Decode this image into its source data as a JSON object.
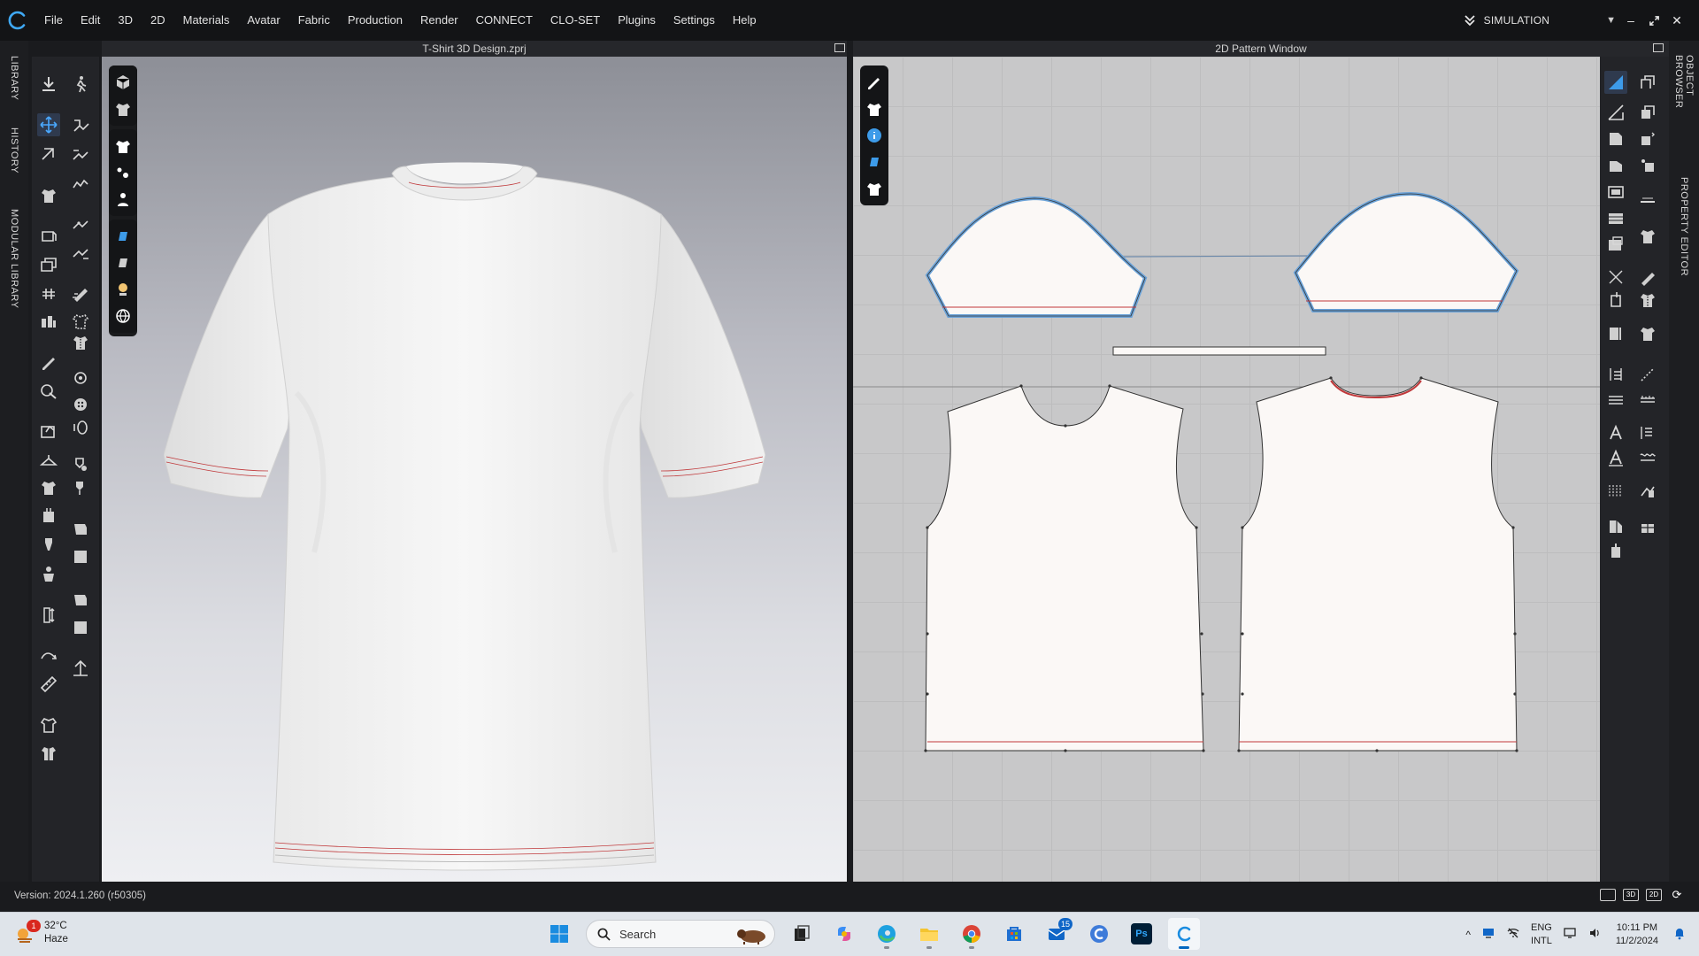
{
  "menubar": {
    "items": [
      "File",
      "Edit",
      "3D",
      "2D",
      "Materials",
      "Avatar",
      "Fabric",
      "Production",
      "Render",
      "CONNECT",
      "CLO-SET",
      "Plugins",
      "Settings",
      "Help"
    ],
    "mode": "SIMULATION"
  },
  "left_tabs": [
    "LIBRARY",
    "HISTORY",
    "MODULAR LIBRARY"
  ],
  "right_tabs": [
    "OBJECT BROWSER",
    "PROPERTY EDITOR"
  ],
  "window3d": {
    "title": "T-Shirt 3D Design.zprj"
  },
  "window2d": {
    "title": "2D Pattern Window"
  },
  "status": {
    "version": "Version: 2024.1.260 (r50305)",
    "view_buttons": [
      "3D",
      "2D"
    ]
  },
  "taskbar": {
    "weather": {
      "temp": "32°C",
      "condition": "Haze",
      "alert_count": "1"
    },
    "search_placeholder": "Search",
    "mail_badge": "15",
    "photoshop_label": "Ps",
    "lang_line1": "ENG",
    "lang_line2": "INTL",
    "time": "10:11 PM",
    "date": "11/2/2024"
  },
  "colors": {
    "accent": "#0067c0",
    "pattern_outline_selected": "#5b9bd5",
    "seam_line": "#c0393b",
    "viewport_bg": "#c8c8c9"
  }
}
